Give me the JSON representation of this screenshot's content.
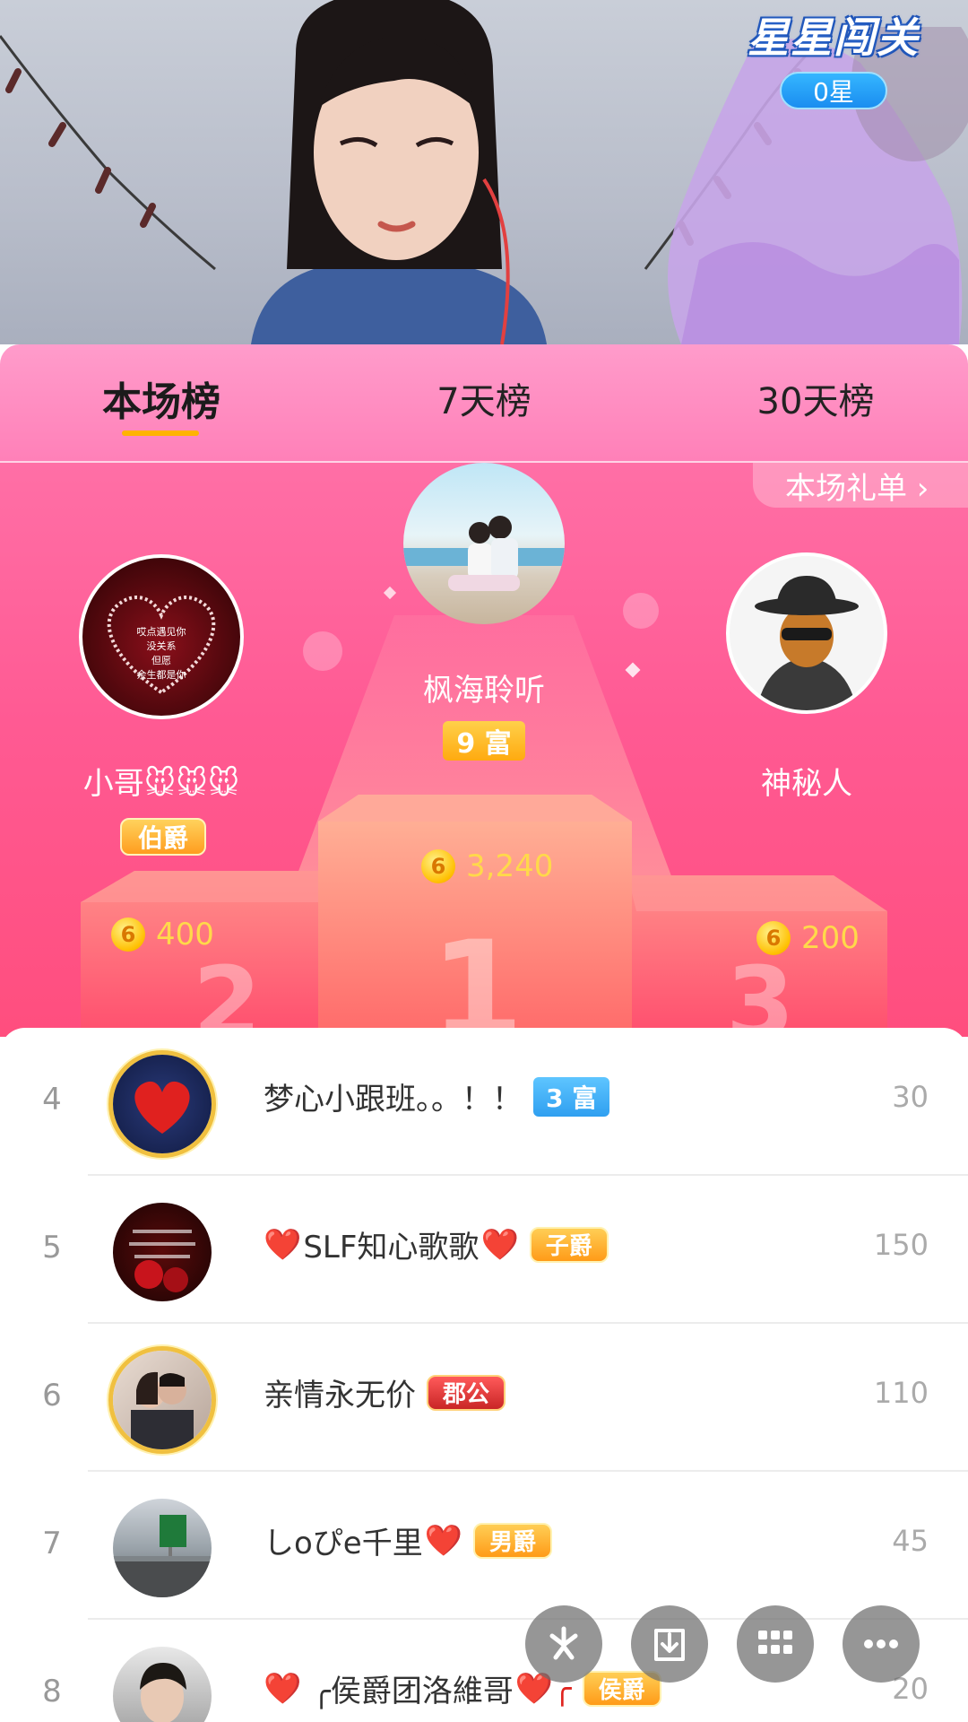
{
  "game_badge": {
    "title": "星星闯关",
    "stars": "0星"
  },
  "tabs": [
    {
      "label": "本场榜",
      "active": true
    },
    {
      "label": "7天榜",
      "active": false
    },
    {
      "label": "30天榜",
      "active": false
    }
  ],
  "gift_list_link": "本场礼单 ›",
  "podium": {
    "first": {
      "rank": "1",
      "name": "枫海聆听",
      "badge": "9 富",
      "coins": "3,240"
    },
    "second": {
      "rank": "2",
      "name": "小哥🐭🐭🐭",
      "badge": "伯爵",
      "coins": "400",
      "avatar_text": "哎点遇见你\n没关系\n但愿\n余生都是你"
    },
    "third": {
      "rank": "3",
      "name": "神秘人",
      "coins": "200"
    },
    "coin_symbol": "6"
  },
  "list": [
    {
      "rank": "4",
      "name": "梦心小跟班。。！！",
      "rich_badge": "3 富",
      "value": "30"
    },
    {
      "rank": "5",
      "name_prefix": "❤️",
      "name": "SLF知心歌歌",
      "name_suffix": "❤️",
      "noble_badge": "子爵",
      "value": "150"
    },
    {
      "rank": "6",
      "name": "亲情永无价",
      "noble_badge": "郡公",
      "value": "110"
    },
    {
      "rank": "7",
      "name": "しoぴe千里",
      "name_suffix": "❤️",
      "noble_badge": "男爵",
      "value": "45"
    },
    {
      "rank": "8",
      "name_prefix": "❤️",
      "name": "╭侯爵团洛維哥",
      "name_suffix": "❤️╭",
      "noble_badge": "侯爵",
      "value": "20"
    }
  ],
  "icons": [
    "share-icon",
    "download-icon",
    "grid-icon",
    "more-icon"
  ],
  "colors": {
    "accent_pink": "#ff5a93",
    "tab_underline": "#ffb300",
    "coin_gold": "#ffd94a"
  }
}
